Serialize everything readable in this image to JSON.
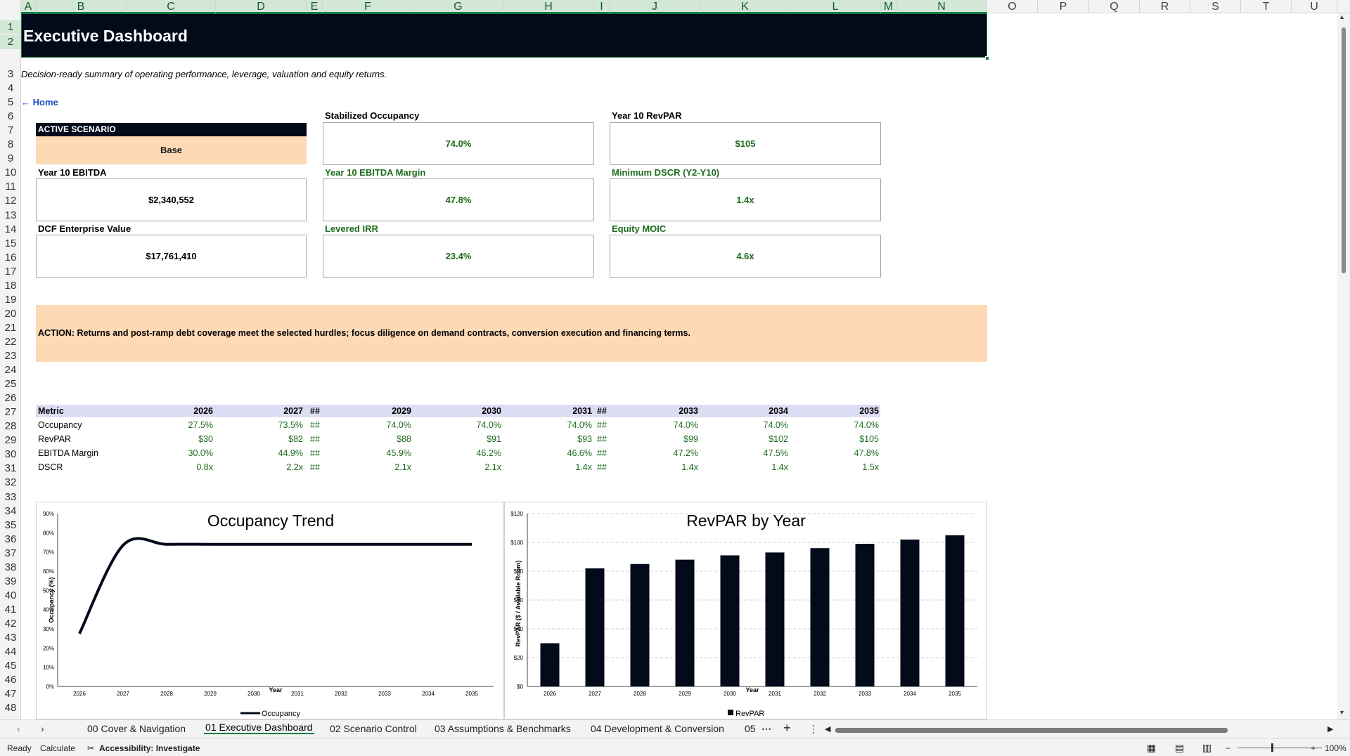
{
  "columns": [
    "A",
    "B",
    "C",
    "D",
    "E",
    "F",
    "G",
    "H",
    "I",
    "J",
    "K",
    "L",
    "M",
    "N",
    "O",
    "P",
    "Q",
    "R",
    "S",
    "T",
    "U"
  ],
  "rows": [
    "1",
    "2",
    "3",
    "4",
    "5",
    "6",
    "7",
    "8",
    "9",
    "10",
    "11",
    "12",
    "13",
    "14",
    "15",
    "16",
    "17",
    "18",
    "19",
    "20",
    "21",
    "22",
    "23",
    "24",
    "25",
    "26",
    "27",
    "28",
    "29",
    "30",
    "31",
    "32",
    "33",
    "34",
    "35",
    "36",
    "37",
    "38",
    "39",
    "40",
    "41",
    "42",
    "43",
    "44",
    "45",
    "46",
    "47",
    "48"
  ],
  "title": "Executive Dashboard",
  "subtitle": "Decision-ready summary of operating performance, leverage, valuation and equity returns.",
  "home_link": "← Home",
  "scenario": {
    "header": "ACTIVE SCENARIO",
    "value": "Base"
  },
  "kpis": {
    "stab_occ": {
      "label": "Stabilized Occupancy",
      "value": "74.0%"
    },
    "y10_revpar": {
      "label": "Year 10 RevPAR",
      "value": "$105"
    },
    "y10_ebitda": {
      "label": "Year 10 EBITDA",
      "value": "$2,340,552"
    },
    "y10_margin": {
      "label": "Year 10 EBITDA Margin",
      "value": "47.8%"
    },
    "min_dscr": {
      "label": "Minimum DSCR (Y2-Y10)",
      "value": "1.4x"
    },
    "dcf_ev": {
      "label": "DCF Enterprise Value",
      "value": "$17,761,410"
    },
    "lev_irr": {
      "label": "Levered IRR",
      "value": "23.4%"
    },
    "moic": {
      "label": "Equity MOIC",
      "value": "4.6x"
    }
  },
  "action": "ACTION: Returns and post-ramp debt coverage meet the selected hurdles; focus diligence on demand contracts, conversion execution and financing terms.",
  "table": {
    "metric_header": "Metric",
    "years": [
      "2026",
      "2027",
      "##",
      "2029",
      "2030",
      "2031",
      "##",
      "2033",
      "2034",
      "2035"
    ],
    "rows": [
      {
        "name": "Occupancy",
        "values": [
          "27.5%",
          "73.5%",
          "##",
          "74.0%",
          "74.0%",
          "74.0%",
          "##",
          "74.0%",
          "74.0%",
          "74.0%"
        ]
      },
      {
        "name": "RevPAR",
        "values": [
          "$30",
          "$82",
          "##",
          "$88",
          "$91",
          "$93",
          "##",
          "$99",
          "$102",
          "$105"
        ]
      },
      {
        "name": "EBITDA Margin",
        "values": [
          "30.0%",
          "44.9%",
          "##",
          "45.9%",
          "46.2%",
          "46.6%",
          "##",
          "47.2%",
          "47.5%",
          "47.8%"
        ]
      },
      {
        "name": "DSCR",
        "values": [
          "0.8x",
          "2.2x",
          "##",
          "2.1x",
          "2.1x",
          "1.4x",
          "##",
          "1.4x",
          "1.4x",
          "1.5x"
        ]
      }
    ]
  },
  "chart_data": [
    {
      "type": "line",
      "title": "Occupancy Trend",
      "xlabel": "Year",
      "ylabel": "Occupancy (%)",
      "x": [
        "2026",
        "2027",
        "2028",
        "2029",
        "2030",
        "2031",
        "2032",
        "2033",
        "2034",
        "2035"
      ],
      "series": [
        {
          "name": "Occupancy",
          "values": [
            27.5,
            73.5,
            74.0,
            74.0,
            74.0,
            74.0,
            74.0,
            74.0,
            74.0,
            74.0
          ]
        }
      ],
      "ylim": [
        0,
        90
      ],
      "yticks": [
        "0%",
        "10%",
        "20%",
        "30%",
        "40%",
        "50%",
        "60%",
        "70%",
        "80%",
        "90%"
      ],
      "legend": "bottom",
      "grid": false,
      "color": "#030a1a"
    },
    {
      "type": "bar",
      "title": "RevPAR by Year",
      "xlabel": "Year",
      "ylabel": "RevPAR ($ / Available Room)",
      "categories": [
        "2026",
        "2027",
        "2028",
        "2029",
        "2030",
        "2031",
        "2032",
        "2033",
        "2034",
        "2035"
      ],
      "series": [
        {
          "name": "RevPAR",
          "values": [
            30,
            82,
            85,
            88,
            91,
            93,
            96,
            99,
            102,
            105
          ]
        }
      ],
      "ylim": [
        0,
        120
      ],
      "yticks": [
        "$0",
        "$20",
        "$40",
        "$60",
        "$80",
        "$100",
        "$120"
      ],
      "legend": "bottom",
      "grid": true,
      "color": "#030a1a"
    }
  ],
  "tabs": [
    "00 Cover & Navigation",
    "01 Executive Dashboard",
    "02 Scenario Control",
    "03 Assumptions & Benchmarks",
    "04 Development & Conversion",
    "05"
  ],
  "status": {
    "ready": "Ready",
    "calculate": "Calculate",
    "accessibility": "Accessibility: Investigate",
    "zoom": "100%"
  }
}
